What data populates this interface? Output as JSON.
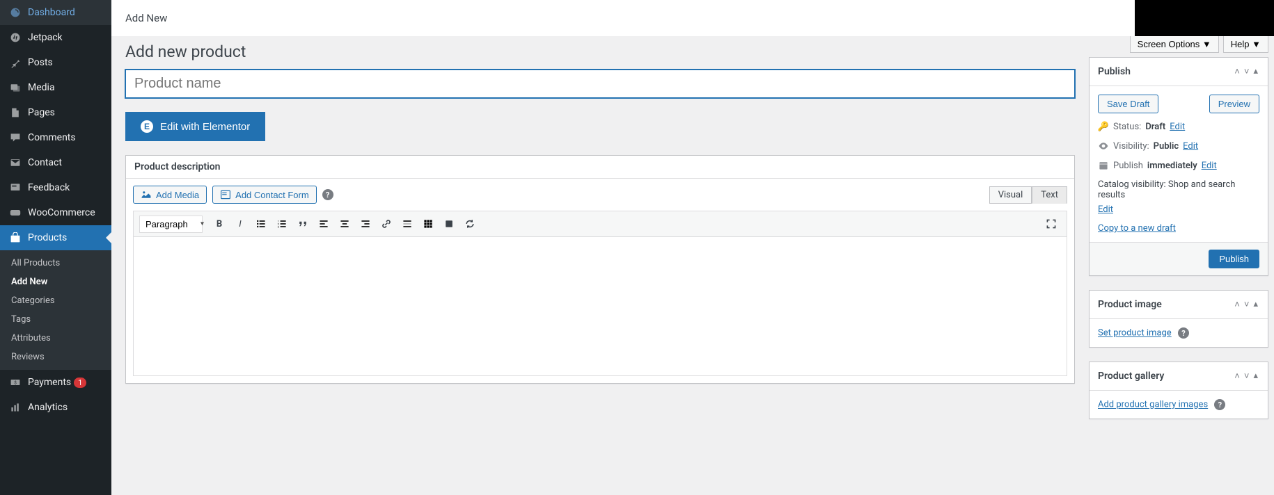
{
  "sidebar": {
    "items": [
      {
        "label": "Dashboard"
      },
      {
        "label": "Jetpack"
      },
      {
        "label": "Posts"
      },
      {
        "label": "Media"
      },
      {
        "label": "Pages"
      },
      {
        "label": "Comments"
      },
      {
        "label": "Contact"
      },
      {
        "label": "Feedback"
      },
      {
        "label": "WooCommerce"
      },
      {
        "label": "Products"
      },
      {
        "label": "Payments"
      },
      {
        "label": "Analytics"
      }
    ],
    "payments_badge": "1",
    "submenu": [
      {
        "label": "All Products"
      },
      {
        "label": "Add New"
      },
      {
        "label": "Categories"
      },
      {
        "label": "Tags"
      },
      {
        "label": "Attributes"
      },
      {
        "label": "Reviews"
      }
    ]
  },
  "topbar": {
    "breadcrumb": "Add New"
  },
  "screen": {
    "options": "Screen Options",
    "help": "Help"
  },
  "page": {
    "title": "Add new product",
    "name_placeholder": "Product name"
  },
  "elementor": {
    "label": "Edit with Elementor"
  },
  "editor": {
    "title": "Product description",
    "add_media": "Add Media",
    "add_contact": "Add Contact Form",
    "tab_visual": "Visual",
    "tab_text": "Text",
    "format": "Paragraph"
  },
  "publish": {
    "title": "Publish",
    "save_draft": "Save Draft",
    "preview": "Preview",
    "status_lbl": "Status:",
    "status_val": "Draft",
    "visibility_lbl": "Visibility:",
    "visibility_val": "Public",
    "publish_lbl": "Publish",
    "publish_val": "immediately",
    "catalog_lbl": "Catalog visibility:",
    "catalog_val": "Shop and search results",
    "edit": "Edit",
    "copy_draft": "Copy to a new draft",
    "publish_btn": "Publish"
  },
  "product_image": {
    "title": "Product image",
    "link": "Set product image"
  },
  "product_gallery": {
    "title": "Product gallery",
    "link": "Add product gallery images"
  }
}
